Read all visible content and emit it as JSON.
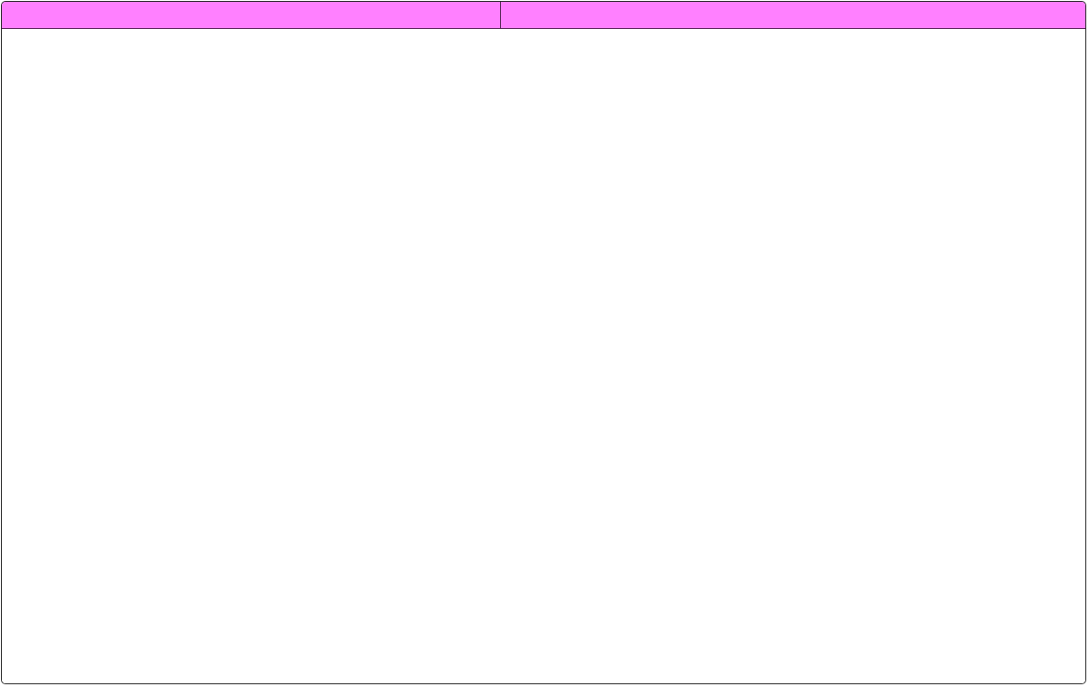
{
  "colors": {
    "tab_background": "#ff80ff",
    "frame_border": "#2a2a2a",
    "content_background": "#ffffff"
  },
  "tabs": [
    {
      "label": ""
    },
    {
      "label": ""
    }
  ]
}
